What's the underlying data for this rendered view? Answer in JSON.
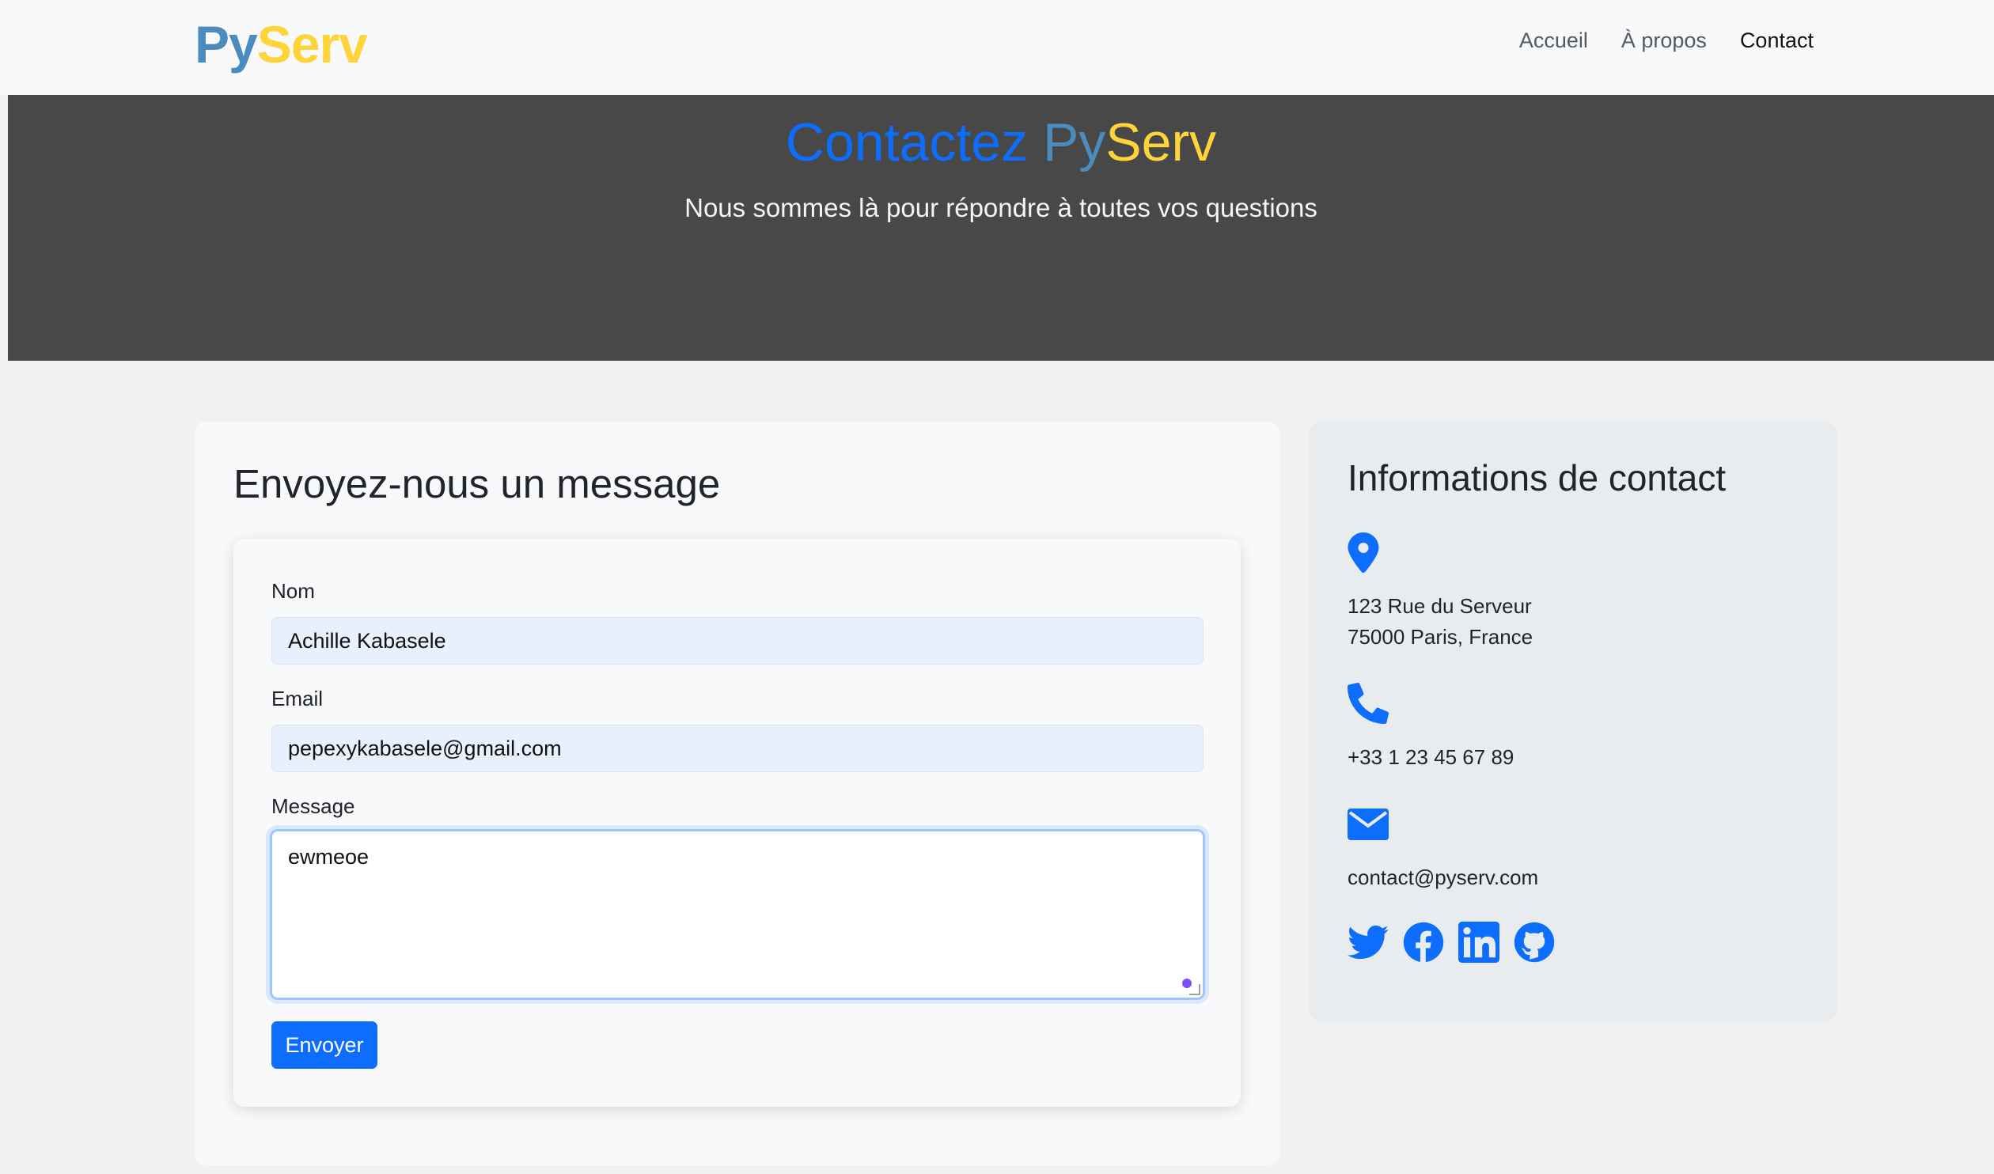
{
  "nav": {
    "brand_py": "Py",
    "brand_serv": "Serv",
    "links": [
      "Accueil",
      "À propos",
      "Contact"
    ],
    "active": "Contact"
  },
  "hero": {
    "title_prefix": "Contactez ",
    "title_py": "Py",
    "title_serv": "Serv",
    "subtitle": "Nous sommes là pour répondre à toutes vos questions"
  },
  "form": {
    "heading": "Envoyez-nous un message",
    "name_label": "Nom",
    "name_value": "Achille Kabasele",
    "email_label": "Email",
    "email_value": "pepexykabasele@gmail.com",
    "message_label": "Message",
    "message_value": "ewmeoe",
    "submit_label": "Envoyer"
  },
  "contact_info": {
    "heading": "Informations de contact",
    "address_line1": "123 Rue du Serveur",
    "address_line2": "75000 Paris, France",
    "phone": "+33 1 23 45 67 89",
    "email": "contact@pyserv.com",
    "icons": [
      "map-marker-icon",
      "phone-icon",
      "envelope-icon"
    ],
    "socials": [
      "twitter-icon",
      "facebook-icon",
      "linkedin-icon",
      "github-icon"
    ]
  },
  "colors": {
    "accent": "#0d6efd",
    "python_blue": "#4b8bbe",
    "python_yellow": "#ffd43b",
    "hero_bg": "#484848"
  }
}
